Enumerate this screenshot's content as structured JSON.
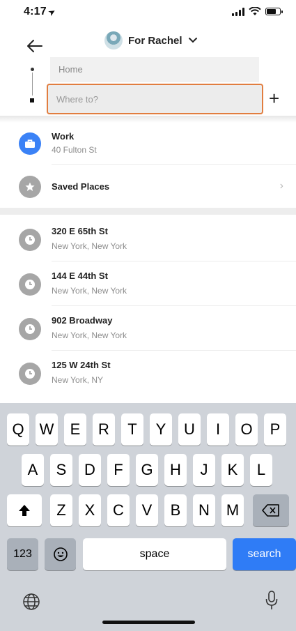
{
  "status": {
    "time": "4:17",
    "battery_level": 0.8
  },
  "header": {
    "rider": "For Rachel",
    "pickup_value": "Home",
    "destination_placeholder": "Where to?"
  },
  "saved": [
    {
      "title": "Work",
      "subtitle": "40 Fulton St",
      "icon": "briefcase-icon",
      "color": "#3b82f6"
    },
    {
      "title": "Saved Places",
      "subtitle": "",
      "icon": "star-icon",
      "color": "#a6a6a6"
    }
  ],
  "recents": [
    {
      "title": "320 E 65th St",
      "subtitle": "New York, New York"
    },
    {
      "title": "144 E 44th St",
      "subtitle": "New York, New York"
    },
    {
      "title": "902 Broadway",
      "subtitle": "New York, New York"
    },
    {
      "title": "125 W 24th St",
      "subtitle": "New York, NY"
    }
  ],
  "keyboard": {
    "row1": [
      "Q",
      "W",
      "E",
      "R",
      "T",
      "Y",
      "U",
      "I",
      "O",
      "P"
    ],
    "row2": [
      "A",
      "S",
      "D",
      "F",
      "G",
      "H",
      "J",
      "K",
      "L"
    ],
    "row3": [
      "Z",
      "X",
      "C",
      "V",
      "B",
      "N",
      "M"
    ],
    "numbers_label": "123",
    "space_label": "space",
    "search_label": "search"
  },
  "colors": {
    "accent_orange": "#e17d3f",
    "search_blue": "#2f7cf6",
    "work_blue": "#3b82f6"
  }
}
